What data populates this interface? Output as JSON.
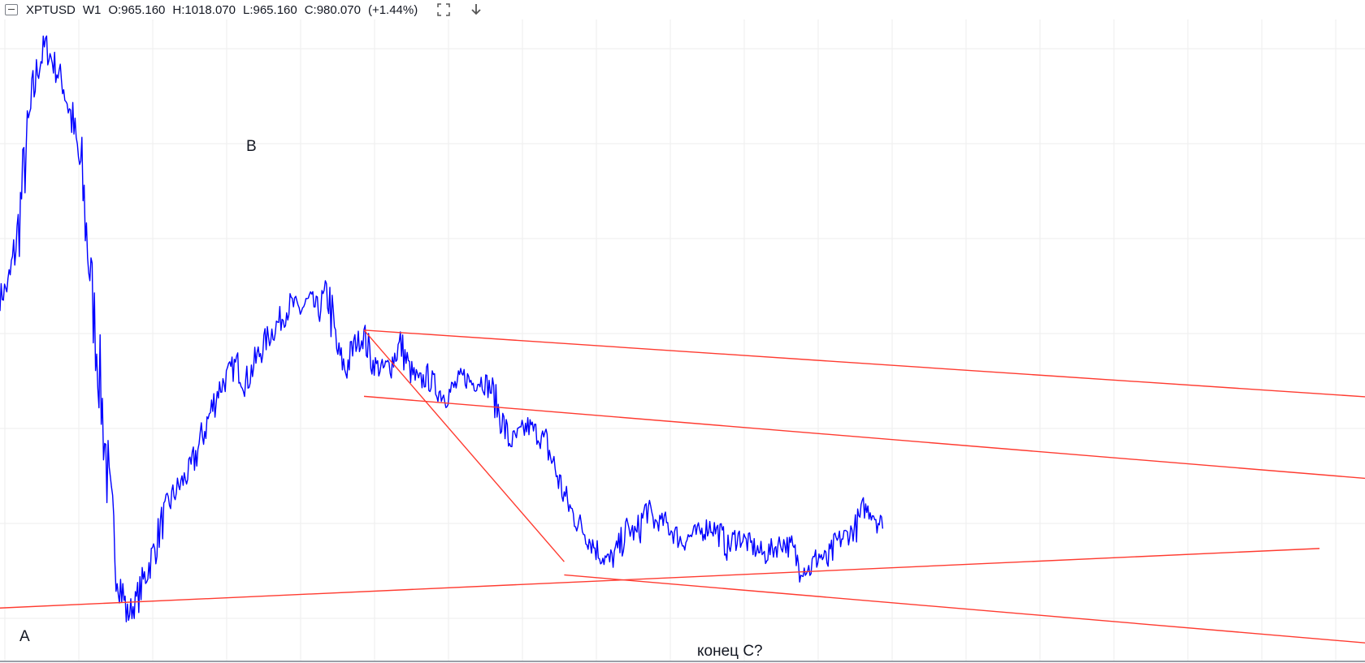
{
  "header": {
    "symbol": "XPTUSD",
    "timeframe": "W1",
    "open": "O:965.160",
    "high": "H:1018.070",
    "low": "L:965.160",
    "close": "C:980.070",
    "change": "(+1.44%)",
    "icons": [
      "collapse-icon",
      "fullscreen-icon",
      "download-arrow-icon"
    ]
  },
  "colors": {
    "price_line": "#0000ff",
    "trend_lines": "#ff3b30",
    "grid": "#eeeeee",
    "background": "#ffffff"
  },
  "annotations": {
    "wave_a": "A",
    "wave_b": "B",
    "wave_c_end": "конец C?"
  },
  "chart_data": {
    "type": "line",
    "title": "",
    "xlabel": "",
    "ylabel": "",
    "grid": true,
    "legend": "none",
    "series": [
      {
        "values": [
          1180,
          1200,
          1280,
          1420,
          1520,
          1560,
          1530,
          1500,
          1440,
          1360,
          1200,
          1050,
          880,
          760,
          700,
          720,
          760,
          800,
          850,
          880,
          900,
          920,
          960,
          1000,
          1040,
          1060,
          1080,
          1050,
          1080,
          1110,
          1130,
          1150,
          1170,
          1160,
          1175,
          1160,
          1190,
          1100,
          1070,
          1110,
          1120,
          1080,
          1070,
          1080,
          1110,
          1070,
          1050,
          1060,
          1040,
          1030,
          1045,
          1060,
          1050,
          1055,
          1040,
          1000,
          960,
          970,
          985,
          975,
          960,
          920,
          880,
          850,
          830,
          810,
          790,
          780,
          800,
          830,
          820,
          860,
          840,
          840,
          825,
          810,
          820,
          825,
          835,
          825,
          800,
          820,
          810,
          800,
          790,
          800,
          810,
          800,
          770,
          770,
          790,
          780,
          810,
          820,
          830,
          860,
          855,
          830
        ]
      }
    ],
    "trendlines": [
      {
        "from": [
          0,
          710
        ],
        "to": [
          145,
          800
        ]
      },
      {
        "from": [
          40,
          1030
        ],
        "to": [
          182,
          870
        ]
      },
      {
        "from": [
          40,
          1130
        ],
        "to": [
          182,
          1000
        ]
      },
      {
        "from": [
          40,
          1130
        ],
        "to": [
          62,
          780
        ]
      },
      {
        "from": [
          62,
          760
        ],
        "to": [
          182,
          620
        ]
      }
    ]
  }
}
